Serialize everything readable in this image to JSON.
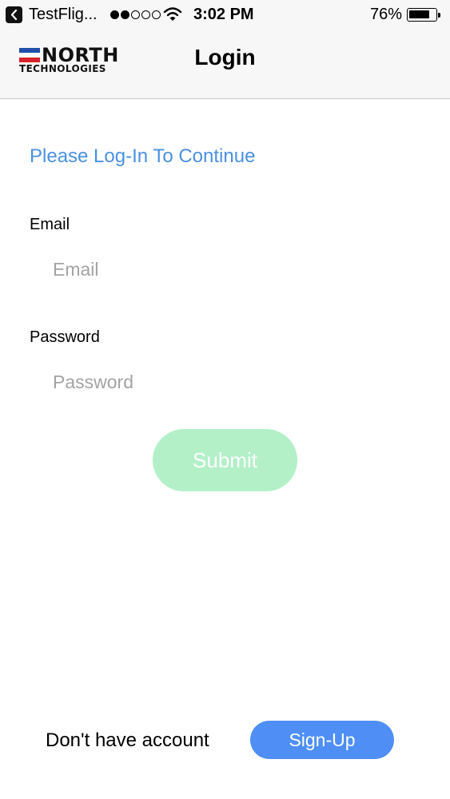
{
  "status_bar": {
    "app_name": "TestFlig...",
    "signal_bars": [
      true,
      true,
      false,
      false,
      false
    ],
    "time": "3:02 PM",
    "battery_percent": "76%",
    "battery_level": 0.76
  },
  "nav": {
    "logo_name": "NORTH",
    "logo_subtitle": "TECHNOLOGIES",
    "title": "Login"
  },
  "form": {
    "prompt": "Please Log-In To Continue",
    "email_label": "Email",
    "email_placeholder": "Email",
    "email_value": "",
    "password_label": "Password",
    "password_placeholder": "Password",
    "password_value": "",
    "submit_label": "Submit"
  },
  "footer": {
    "text": "Don't have account",
    "signup_label": "Sign-Up"
  },
  "colors": {
    "accent_blue": "#4a90e2",
    "submit_green": "#b3f0c8",
    "signup_blue": "#4f8ff5"
  }
}
